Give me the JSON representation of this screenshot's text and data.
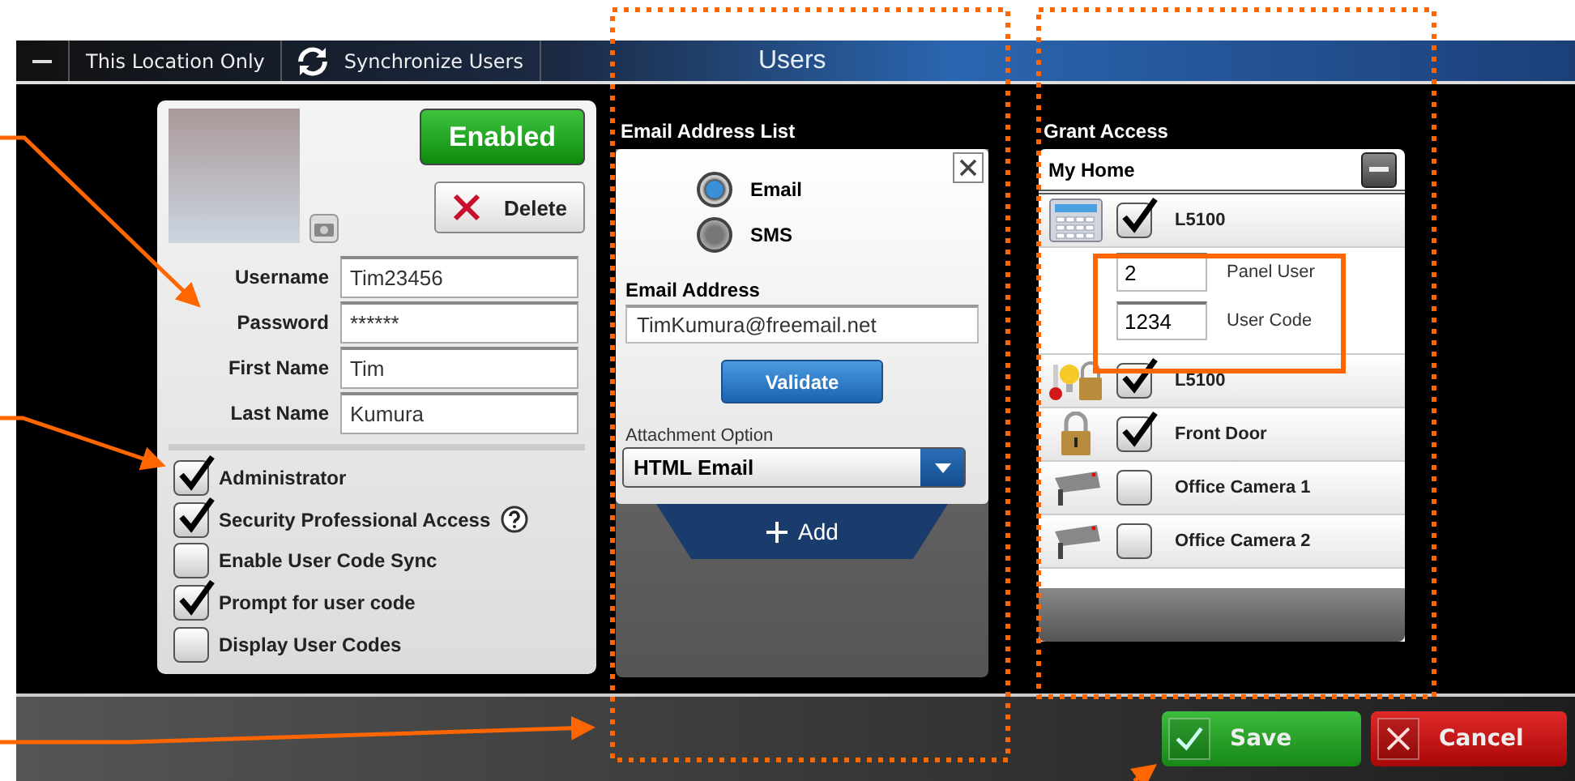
{
  "toolbar": {
    "items": [
      "This Location Only",
      "Synchronize Users"
    ],
    "title": "Users"
  },
  "user": {
    "status": "Enabled",
    "enabled": true,
    "delete": "Delete",
    "fields": [
      {
        "label": "Username",
        "value": "Tim23456"
      },
      {
        "label": "Password",
        "value": "******"
      },
      {
        "label": "First Name",
        "value": "Tim"
      },
      {
        "label": "Last Name",
        "value": "Kumura"
      }
    ],
    "options": [
      {
        "label": "Administrator",
        "checked": true,
        "help": false
      },
      {
        "label": "Security Professional Access",
        "checked": true,
        "help": true
      },
      {
        "label": "Enable User Code Sync",
        "checked": false,
        "help": false
      },
      {
        "label": "Prompt for user code",
        "checked": true,
        "help": false
      },
      {
        "label": "Display User Codes",
        "checked": false,
        "help": false
      }
    ]
  },
  "email_list": {
    "heading": "Email Address List",
    "methods": [
      {
        "label": "Email",
        "selected": true
      },
      {
        "label": "SMS",
        "selected": false
      }
    ],
    "address_label": "Email Address",
    "address": "TimKumura@freemail.net",
    "validate": "Validate",
    "attachment_label": "Attachment Option",
    "attachment": "HTML Email",
    "add": "Add"
  },
  "grant_access": {
    "heading": "Grant Access",
    "location": "My Home",
    "devices": [
      {
        "kind": "panel",
        "name": "L5100",
        "checked": true,
        "fields": [
          {
            "value": "2",
            "label": "Panel User"
          },
          {
            "value": "1234",
            "label": "User Code"
          }
        ]
      },
      {
        "kind": "sensors",
        "name": "L5100",
        "checked": true
      },
      {
        "kind": "lock",
        "name": "Front Door",
        "checked": true
      },
      {
        "kind": "camera",
        "name": "Office Camera 1",
        "checked": false
      },
      {
        "kind": "camera",
        "name": "Office Camera 2",
        "checked": false
      }
    ]
  },
  "actions": {
    "save": "Save",
    "cancel": "Cancel"
  }
}
